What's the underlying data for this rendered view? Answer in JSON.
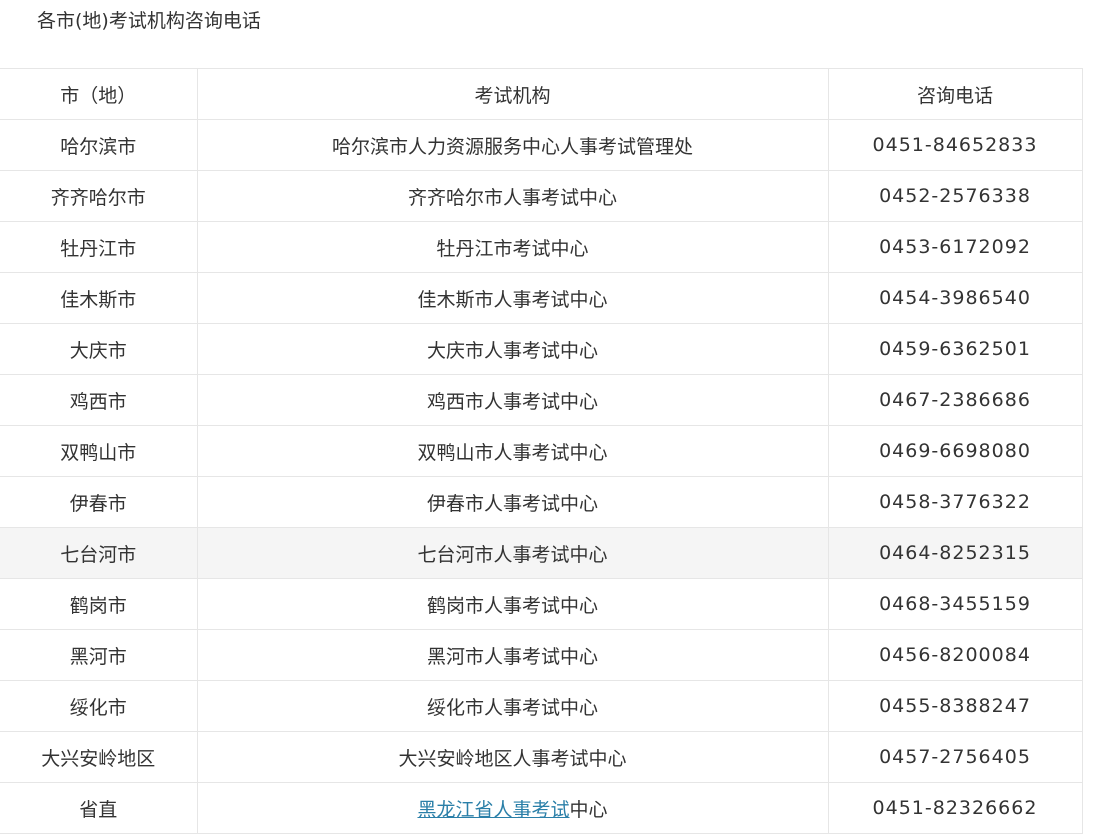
{
  "title": "各市(地)考试机构咨询电话",
  "table": {
    "headers": [
      "市（地）",
      "考试机构",
      "咨询电话"
    ],
    "rows": [
      {
        "city": "哈尔滨市",
        "org": "哈尔滨市人力资源服务中心人事考试管理处",
        "phone": "0451-84652833"
      },
      {
        "city": "齐齐哈尔市",
        "org": "齐齐哈尔市人事考试中心",
        "phone": "0452-2576338"
      },
      {
        "city": "牡丹江市",
        "org": "牡丹江市考试中心",
        "phone": "0453-6172092"
      },
      {
        "city": "佳木斯市",
        "org": "佳木斯市人事考试中心",
        "phone": "0454-3986540"
      },
      {
        "city": "大庆市",
        "org": "大庆市人事考试中心",
        "phone": "0459-6362501"
      },
      {
        "city": "鸡西市",
        "org": "鸡西市人事考试中心",
        "phone": "0467-2386686"
      },
      {
        "city": "双鸭山市",
        "org": "双鸭山市人事考试中心",
        "phone": "0469-6698080"
      },
      {
        "city": "伊春市",
        "org": "伊春市人事考试中心",
        "phone": "0458-3776322"
      },
      {
        "city": "七台河市",
        "org": "七台河市人事考试中心",
        "phone": "0464-8252315"
      },
      {
        "city": "鹤岗市",
        "org": "鹤岗市人事考试中心",
        "phone": "0468-3455159"
      },
      {
        "city": "黑河市",
        "org": "黑河市人事考试中心",
        "phone": "0456-8200084"
      },
      {
        "city": "绥化市",
        "org": "绥化市人事考试中心",
        "phone": "0455-8388247"
      },
      {
        "city": "大兴安岭地区",
        "org": "大兴安岭地区人事考试中心",
        "phone": "0457-2756405"
      },
      {
        "city": "省直",
        "org_link": "黑龙江省人事考试",
        "org_suffix": "中心",
        "phone": "0451-82326662"
      }
    ]
  },
  "colors": {
    "text": "#333333",
    "border": "#e6e6e6",
    "highlight_row": "#f5f5f5",
    "link": "#2a7fa8"
  }
}
